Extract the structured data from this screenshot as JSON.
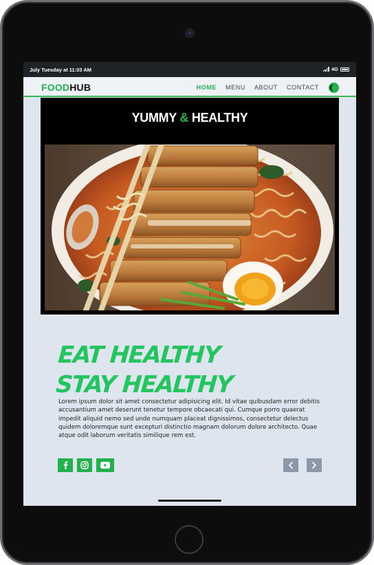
{
  "status_bar": {
    "time": "July Tuesday at 11:03 AM",
    "network": "4G"
  },
  "navbar": {
    "logo_part1": "FOOD",
    "logo_part2": "HUB",
    "links": [
      {
        "label": "HOME",
        "active": true
      },
      {
        "label": "MENU",
        "active": false
      },
      {
        "label": "ABOUT",
        "active": false
      },
      {
        "label": "CONTACT",
        "active": false
      }
    ],
    "theme_toggle_icon": "moon-icon"
  },
  "hero": {
    "title_part1": "YUMMY ",
    "title_amp": "&",
    "title_part2": " HEALTHY",
    "image_subject": "ramen bowl with breaded chicken cutlet, noodles, soft boiled egg, chopsticks"
  },
  "content": {
    "headline_line1": "EAT HEALTHY",
    "headline_line2": "STAY HEALTHY",
    "paragraph": "Lorem ipsum dolor sit amet consectetur adipisicing elit. Id vitae quibusdam error debitis accusantium amet deserunt tenetur tempore obcaecati qui. Cumque porro quaerat impedit aliquid nemo sed unde numquam placeat dignissimos, consectetur delectus quidem doloremque sunt excepturi distinctio magnam dolorum dolore architecto. Quae atque odit laborum veritatis similique rem est."
  },
  "socials": [
    {
      "icon": "facebook-icon"
    },
    {
      "icon": "instagram-icon"
    },
    {
      "icon": "youtube-icon"
    }
  ],
  "slider_controls": {
    "prev_icon": "chevron-left-icon",
    "next_icon": "chevron-right-icon"
  },
  "colors": {
    "accent": "#22b14c",
    "headline": "#22c55e",
    "page_bg": "#dfe5ee",
    "arrow_bg": "#8c97a7"
  }
}
